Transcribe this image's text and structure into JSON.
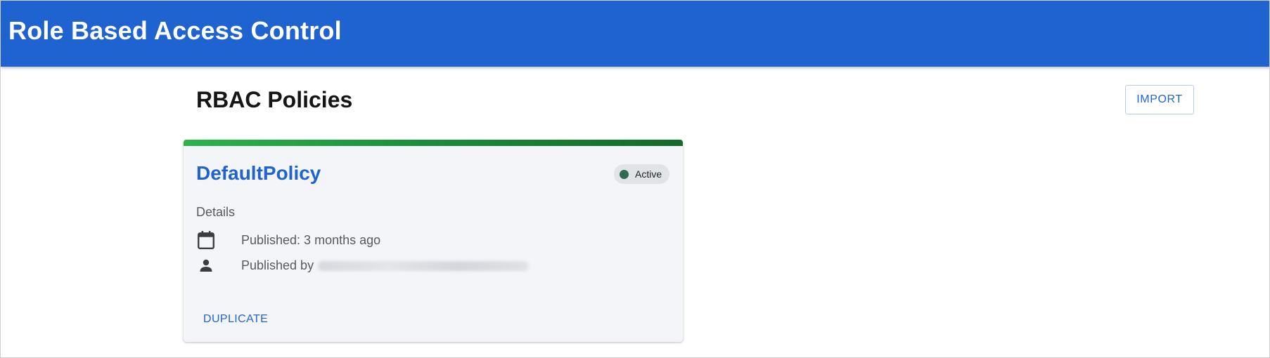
{
  "app": {
    "title": "Role Based Access Control"
  },
  "page": {
    "heading": "RBAC Policies",
    "import_label": "IMPORT"
  },
  "policy_card": {
    "name": "DefaultPolicy",
    "status": "Active",
    "status_color": "#2e6b52",
    "details_label": "Details",
    "published_label": "Published: 3 months ago",
    "published_by_label": "Published by",
    "published_by_value_redacted": true,
    "duplicate_label": "DUPLICATE",
    "accent_colors": [
      "#2db34c",
      "#14692b"
    ],
    "icons": {
      "published": "calendar-icon",
      "published_by": "person-icon"
    }
  },
  "theme": {
    "primary": "#1f63d0",
    "card_background": "#f3f5f9"
  }
}
